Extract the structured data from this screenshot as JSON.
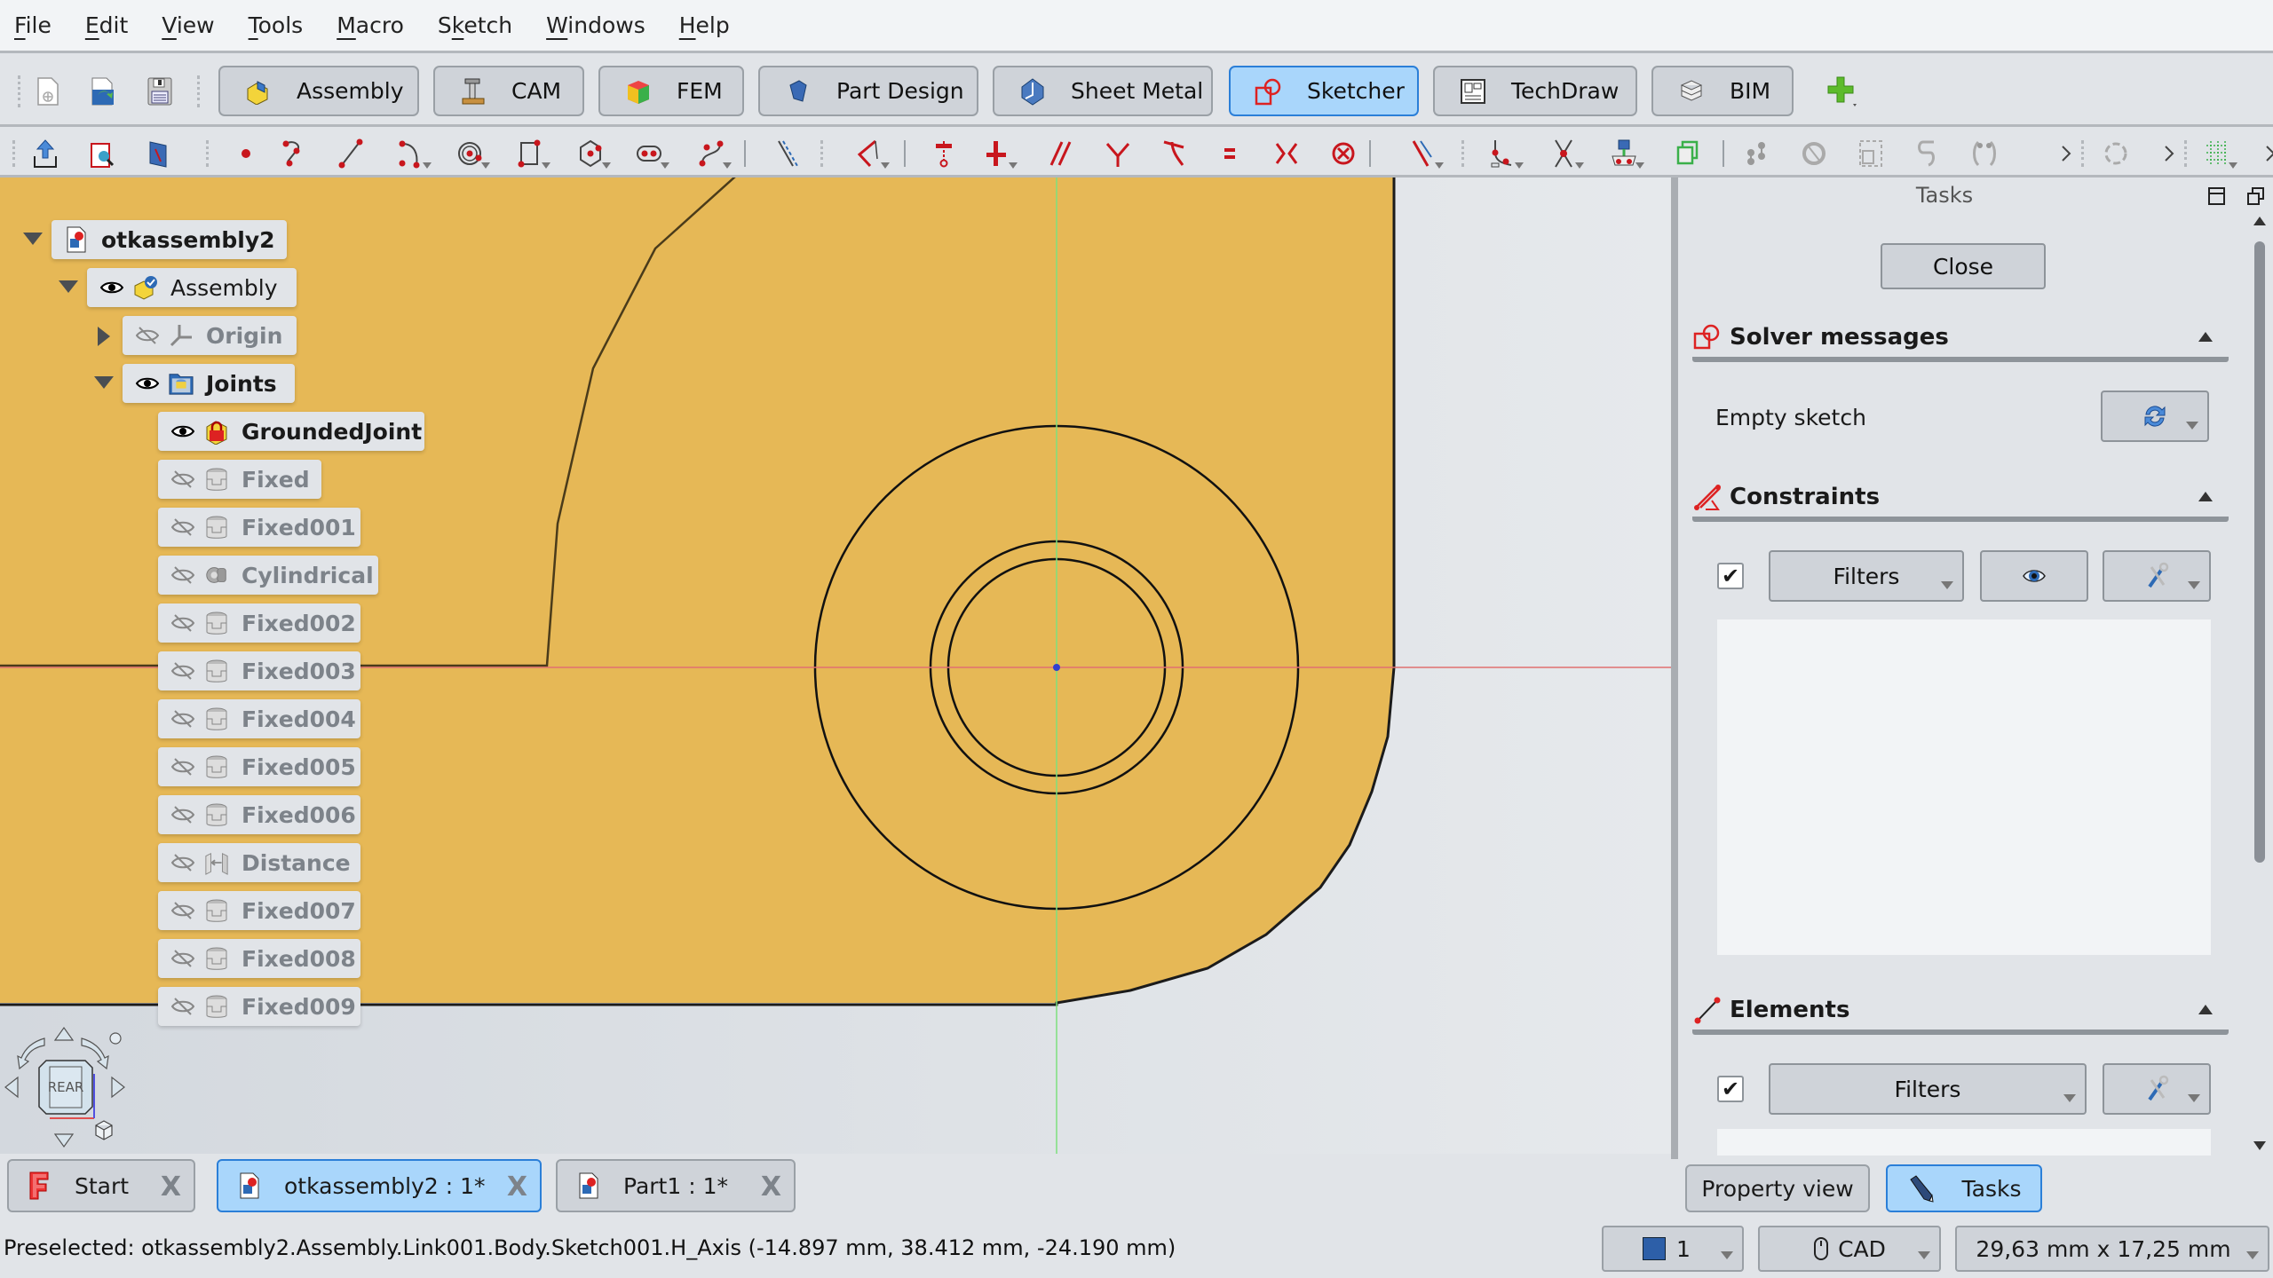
{
  "menu": [
    "File",
    "Edit",
    "View",
    "Tools",
    "Macro",
    "Sketch",
    "Windows",
    "Help"
  ],
  "menu_mnemonics": [
    0,
    0,
    0,
    0,
    0,
    1,
    0,
    0
  ],
  "workbenches": [
    {
      "label": "Assembly",
      "icon": "assembly-icon",
      "active": false
    },
    {
      "label": "CAM",
      "icon": "cam-icon",
      "active": false
    },
    {
      "label": "FEM",
      "icon": "fem-icon",
      "active": false
    },
    {
      "label": "Part Design",
      "icon": "part-design-icon",
      "active": false
    },
    {
      "label": "Sheet Metal",
      "icon": "sheet-metal-icon",
      "active": false
    },
    {
      "label": "Sketcher",
      "icon": "sketcher-icon",
      "active": true
    },
    {
      "label": "TechDraw",
      "icon": "techdraw-icon",
      "active": false
    },
    {
      "label": "BIM",
      "icon": "bim-icon",
      "active": false
    }
  ],
  "file_toolbar": [
    "new-document-icon",
    "open-document-icon",
    "save-document-icon"
  ],
  "sketch_toolbar": [
    "leave-sketch-icon",
    "view-sketch-icon",
    "view-section-icon",
    "point-icon",
    "polyline-icon",
    "line-icon",
    "arc-icon",
    "circle-icon",
    "rectangle-icon",
    "polygon-icon",
    "slot-icon",
    "bspline-icon",
    "construction-mode-icon",
    "external-geometry-icon",
    "coincident-constraint-icon",
    "horizontal-vertical-constraint-icon",
    "parallel-constraint-icon",
    "perpendicular-constraint-icon",
    "tangent-constraint-icon",
    "equal-constraint-icon",
    "symmetric-constraint-icon",
    "block-constraint-icon",
    "dimension-icon",
    "fillet-icon",
    "trim-icon",
    "external-projection-icon",
    "carbon-copy-icon",
    "select-points-icon",
    "rotate-icon",
    "scale-icon",
    "offset-icon",
    "symmetry-icon",
    "more-icon",
    "validate-icon",
    "more-icon-2",
    "grid-icon",
    "more-icon-3"
  ],
  "tree": {
    "root": "otkassembly2",
    "assembly": "Assembly",
    "origin": "Origin",
    "joints": "Joints",
    "joint_items": [
      {
        "label": "GroundedJoint",
        "visible": true,
        "icon": "grounded-joint-icon"
      },
      {
        "label": "Fixed",
        "visible": false,
        "icon": "fixed-joint-icon"
      },
      {
        "label": "Fixed001",
        "visible": false,
        "icon": "fixed-joint-icon"
      },
      {
        "label": "Cylindrical",
        "visible": false,
        "icon": "cylindrical-joint-icon"
      },
      {
        "label": "Fixed002",
        "visible": false,
        "icon": "fixed-joint-icon"
      },
      {
        "label": "Fixed003",
        "visible": false,
        "icon": "fixed-joint-icon"
      },
      {
        "label": "Fixed004",
        "visible": false,
        "icon": "fixed-joint-icon"
      },
      {
        "label": "Fixed005",
        "visible": false,
        "icon": "fixed-joint-icon"
      },
      {
        "label": "Fixed006",
        "visible": false,
        "icon": "fixed-joint-icon"
      },
      {
        "label": "Distance",
        "visible": false,
        "icon": "distance-joint-icon"
      },
      {
        "label": "Fixed007",
        "visible": false,
        "icon": "fixed-joint-icon"
      },
      {
        "label": "Fixed008",
        "visible": false,
        "icon": "fixed-joint-icon"
      },
      {
        "label": "Fixed009",
        "visible": false,
        "icon": "fixed-joint-icon"
      }
    ]
  },
  "navcube": {
    "face": "REAR"
  },
  "tasks": {
    "title": "Tasks",
    "close_label": "Close",
    "solver": {
      "title": "Solver messages",
      "message": "Empty sketch"
    },
    "constraints": {
      "title": "Constraints",
      "filters_label": "Filters",
      "checked": true
    },
    "elements": {
      "title": "Elements",
      "filters_label": "Filters",
      "checked": true
    }
  },
  "panel_tabs": [
    {
      "label": "Property view",
      "active": false
    },
    {
      "label": "Tasks",
      "active": true
    }
  ],
  "doc_tabs": [
    {
      "label": "Start",
      "active": false
    },
    {
      "label": "otkassembly2 : 1*",
      "active": true
    },
    {
      "label": "Part1 : 1*",
      "active": false
    }
  ],
  "statusbar": {
    "message": "Preselected: otkassembly2.Assembly.Link001.Body.Sketch001.H_Axis (-14.897 mm, 38.412 mm, -24.190 mm)",
    "view_count": "1",
    "nav_style": "CAD",
    "dimensions": "29,63 mm x 17,25 mm"
  },
  "colors": {
    "active_accent": "#2b7fd8",
    "active_fill": "#a9d6fb",
    "part_face": "#e6b856",
    "h_axis": "#e07070",
    "v_axis": "#7ee07e"
  }
}
